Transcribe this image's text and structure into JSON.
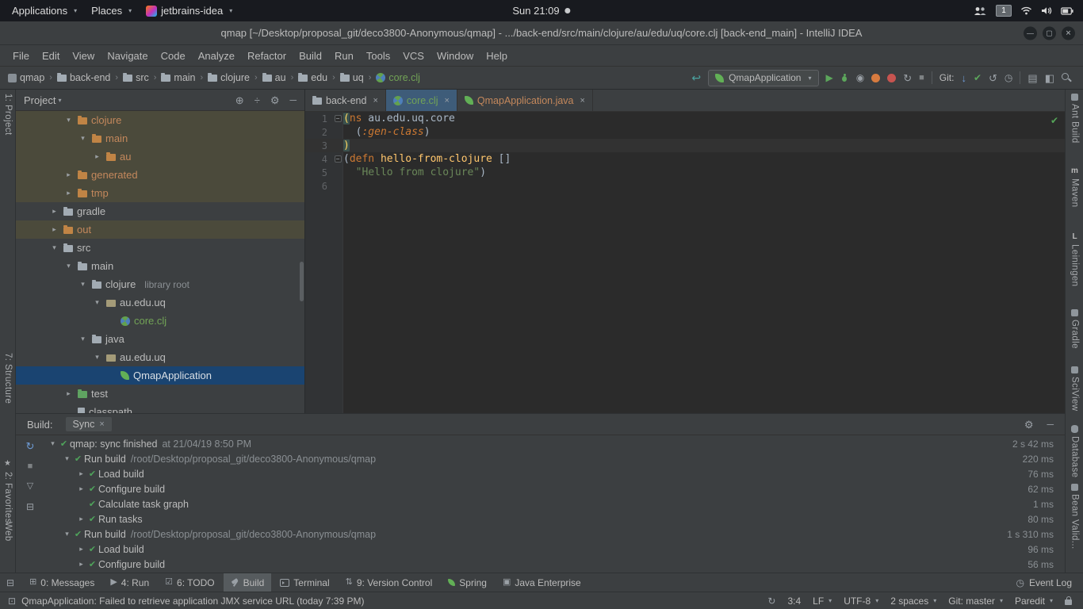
{
  "system_bar": {
    "applications_menu": "Applications",
    "places_menu": "Places",
    "app_menu": "jetbrains-idea",
    "clock": "Sun 21:09",
    "workspace_number": "1"
  },
  "window": {
    "title": "qmap [~/Desktop/proposal_git/deco3800-Anonymous/qmap] - .../back-end/src/main/clojure/au/edu/uq/core.clj [back-end_main] - IntelliJ IDEA"
  },
  "menu_bar": [
    "File",
    "Edit",
    "View",
    "Navigate",
    "Code",
    "Analyze",
    "Refactor",
    "Build",
    "Run",
    "Tools",
    "VCS",
    "Window",
    "Help"
  ],
  "toolbar": {
    "breadcrumbs": [
      {
        "label": "qmap",
        "icon": "project"
      },
      {
        "label": "back-end",
        "icon": "folder"
      },
      {
        "label": "src",
        "icon": "folder"
      },
      {
        "label": "main",
        "icon": "folder"
      },
      {
        "label": "clojure",
        "icon": "folder"
      },
      {
        "label": "au",
        "icon": "folder"
      },
      {
        "label": "edu",
        "icon": "folder"
      },
      {
        "label": "uq",
        "icon": "folder"
      },
      {
        "label": "core.clj",
        "icon": "clojure",
        "color": "green"
      }
    ],
    "run_config": "QmapApplication",
    "git_label": "Git:",
    "left_icons": [
      "back-icon"
    ],
    "run_icons": [
      "run-icon",
      "debug-icon",
      "coverage-icon",
      "profiler-icon",
      "attach-profiler-icon",
      "rerun-icon",
      "stop-icon"
    ],
    "git_icons": [
      "update-project-icon",
      "commit-icon",
      "rollback-icon",
      "history-icon"
    ],
    "right_icons": [
      "structure-icon",
      "layout-icon",
      "search-icon"
    ]
  },
  "left_strip": [
    "1: Project",
    "7: Structure",
    "2: Favorites",
    "Web"
  ],
  "right_strip": [
    "Ant Build",
    "Maven",
    "Leiningen",
    "Gradle",
    "SciView",
    "Database",
    "Bean Valid..."
  ],
  "project_panel": {
    "title": "Project",
    "header_icons": [
      "locate-icon",
      "collapse-all-icon",
      "settings-icon",
      "hide-icon"
    ],
    "tree": [
      {
        "label": "clojure",
        "level": 3,
        "arrow": "down",
        "icon": "folder-orange",
        "color": "orange",
        "bg": "olive"
      },
      {
        "label": "main",
        "level": 4,
        "arrow": "down",
        "icon": "folder-orange",
        "color": "orange",
        "bg": "olive"
      },
      {
        "label": "au",
        "level": 5,
        "arrow": "right",
        "icon": "folder-orange",
        "color": "orange",
        "bg": "olive"
      },
      {
        "label": "generated",
        "level": 3,
        "arrow": "right",
        "icon": "folder-orange",
        "color": "orange",
        "bg": "olive"
      },
      {
        "label": "tmp",
        "level": 3,
        "arrow": "right",
        "icon": "folder-orange",
        "color": "orange",
        "bg": "olive"
      },
      {
        "label": "gradle",
        "level": 2,
        "arrow": "right",
        "icon": "folder"
      },
      {
        "label": "out",
        "level": 2,
        "arrow": "right",
        "icon": "folder-orange",
        "color": "orange",
        "bg": "olive"
      },
      {
        "label": "src",
        "level": 2,
        "arrow": "down",
        "icon": "folder"
      },
      {
        "label": "main",
        "level": 3,
        "arrow": "down",
        "icon": "folder"
      },
      {
        "label": "clojure",
        "level": 4,
        "arrow": "down",
        "icon": "folder",
        "annotation": "library root"
      },
      {
        "label": "au.edu.uq",
        "level": 5,
        "arrow": "down",
        "icon": "package"
      },
      {
        "label": "core.clj",
        "level": 6,
        "arrow": "none",
        "icon": "clojure",
        "color": "green"
      },
      {
        "label": "java",
        "level": 4,
        "arrow": "down",
        "icon": "folder"
      },
      {
        "label": "au.edu.uq",
        "level": 5,
        "arrow": "down",
        "icon": "package"
      },
      {
        "label": "QmapApplication",
        "level": 6,
        "arrow": "none",
        "icon": "spring",
        "selected": true
      },
      {
        "label": "test",
        "level": 3,
        "arrow": "right",
        "icon": "folder-test"
      },
      {
        "label": "classpath",
        "level": 3,
        "arrow": "none",
        "icon": "file"
      }
    ]
  },
  "editor": {
    "tabs": [
      {
        "label": "back-end",
        "icon": "folder"
      },
      {
        "label": "core.clj",
        "icon": "clojure",
        "active": true,
        "color": "green"
      },
      {
        "label": "QmapApplication.java",
        "icon": "spring",
        "color": "orange"
      }
    ],
    "lines": [
      {
        "num": 1,
        "fold": true,
        "segments": [
          {
            "t": "(",
            "c": "match"
          },
          {
            "t": "ns",
            "c": "kw"
          },
          {
            "t": " au.edu.uq.core",
            "c": "plain"
          }
        ]
      },
      {
        "num": 2,
        "segments": [
          {
            "t": "  (",
            "c": "plain"
          },
          {
            "t": ":gen-class",
            "c": "kwlit"
          },
          {
            "t": ")",
            "c": "plain"
          }
        ]
      },
      {
        "num": 3,
        "caret": true,
        "segments": [
          {
            "t": ")",
            "c": "match"
          }
        ]
      },
      {
        "num": 4,
        "fold": true,
        "segments": [
          {
            "t": "(",
            "c": "plain"
          },
          {
            "t": "defn",
            "c": "kw"
          },
          {
            "t": " ",
            "c": "plain"
          },
          {
            "t": "hello-from-clojure",
            "c": "fn"
          },
          {
            "t": " []",
            "c": "plain"
          }
        ]
      },
      {
        "num": 5,
        "segments": [
          {
            "t": "  ",
            "c": "plain"
          },
          {
            "t": "\"Hello from clojure\"",
            "c": "str"
          },
          {
            "t": ")",
            "c": "plain"
          }
        ]
      },
      {
        "num": 6,
        "segments": []
      }
    ]
  },
  "build_panel": {
    "label": "Build:",
    "tab": "Sync",
    "side_icons": [
      "refresh-icon",
      "stop-icon",
      "filter-icon",
      "pin-icon"
    ],
    "header_icons": [
      "settings-icon",
      "hide-icon"
    ],
    "rows": [
      {
        "level": 0,
        "arrow": "down",
        "label": "qmap: sync finished",
        "detail": "at 21/04/19 8:50 PM",
        "duration": "2 s 42 ms"
      },
      {
        "level": 1,
        "arrow": "down",
        "label": "Run build",
        "detail": "/root/Desktop/proposal_git/deco3800-Anonymous/qmap",
        "duration": "220 ms"
      },
      {
        "level": 2,
        "arrow": "right",
        "label": "Load build",
        "duration": "76 ms"
      },
      {
        "level": 2,
        "arrow": "right",
        "label": "Configure build",
        "duration": "62 ms"
      },
      {
        "level": 2,
        "arrow": "none",
        "label": "Calculate task graph",
        "duration": "1 ms"
      },
      {
        "level": 2,
        "arrow": "right",
        "label": "Run tasks",
        "duration": "80 ms"
      },
      {
        "level": 1,
        "arrow": "down",
        "label": "Run build",
        "detail": "/root/Desktop/proposal_git/deco3800-Anonymous/qmap",
        "duration": "1 s 310 ms"
      },
      {
        "level": 2,
        "arrow": "right",
        "label": "Load build",
        "duration": "96 ms"
      },
      {
        "level": 2,
        "arrow": "right",
        "label": "Configure build",
        "duration": "56 ms"
      }
    ]
  },
  "bottom_bar": {
    "items": [
      {
        "icon": "window",
        "label": "0: Messages"
      },
      {
        "icon": "play",
        "label": "4: Run"
      },
      {
        "icon": "todo",
        "label": "6: TODO"
      },
      {
        "icon": "hammer",
        "label": "Build",
        "active": true
      },
      {
        "icon": "terminal",
        "label": "Terminal"
      },
      {
        "icon": "vcs",
        "label": "9: Version Control"
      },
      {
        "icon": "spring",
        "label": "Spring"
      },
      {
        "icon": "javaee",
        "label": "Java Enterprise"
      }
    ],
    "event_log": "Event Log"
  },
  "status_bar": {
    "message": "QmapApplication: Failed to retrieve application JMX service URL (today 7:39 PM)",
    "widgets": [
      "3:4",
      "LF",
      "UTF-8",
      "2 spaces",
      "Git: master",
      "Paredit"
    ]
  }
}
